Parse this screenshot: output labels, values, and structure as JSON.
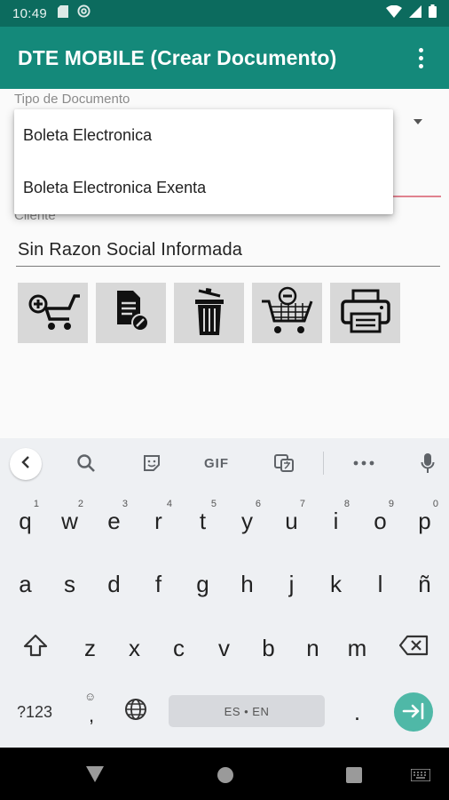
{
  "status_bar": {
    "time": "10:49",
    "left_icons": [
      "sd-card-icon",
      "at-sign-icon"
    ],
    "right_icons": [
      "wifi-icon",
      "signal-icon",
      "battery-icon"
    ]
  },
  "app_bar": {
    "title": "DTE MOBILE (Crear Documento)",
    "menu_icon": "more-vert-icon",
    "color": "#14897a"
  },
  "form": {
    "tipo_label": "Tipo de Documento",
    "dropdown_options": [
      "Boleta Electronica",
      "Boleta Electronica Exenta"
    ],
    "cliente_label": "Cliente",
    "cliente_value": "Sin Razon Social Informada",
    "actions": [
      {
        "name": "add-to-cart-icon"
      },
      {
        "name": "document-edit-icon"
      },
      {
        "name": "trash-icon"
      },
      {
        "name": "remove-from-cart-icon"
      },
      {
        "name": "printer-icon"
      }
    ]
  },
  "keyboard": {
    "toolbar": {
      "gif_label": "GIF"
    },
    "row1": [
      {
        "k": "q",
        "h": "1"
      },
      {
        "k": "w",
        "h": "2"
      },
      {
        "k": "e",
        "h": "3"
      },
      {
        "k": "r",
        "h": "4"
      },
      {
        "k": "t",
        "h": "5"
      },
      {
        "k": "y",
        "h": "6"
      },
      {
        "k": "u",
        "h": "7"
      },
      {
        "k": "i",
        "h": "8"
      },
      {
        "k": "o",
        "h": "9"
      },
      {
        "k": "p",
        "h": "0"
      }
    ],
    "row2": [
      "a",
      "s",
      "d",
      "f",
      "g",
      "h",
      "j",
      "k",
      "l",
      "ñ"
    ],
    "row3": [
      "z",
      "x",
      "c",
      "v",
      "b",
      "n",
      "m"
    ],
    "symbols_label": "?123",
    "comma": ",",
    "emoji_hint": "☺",
    "space_label": "ES • EN",
    "period": ".",
    "accent_color": "#4fb8a7"
  }
}
